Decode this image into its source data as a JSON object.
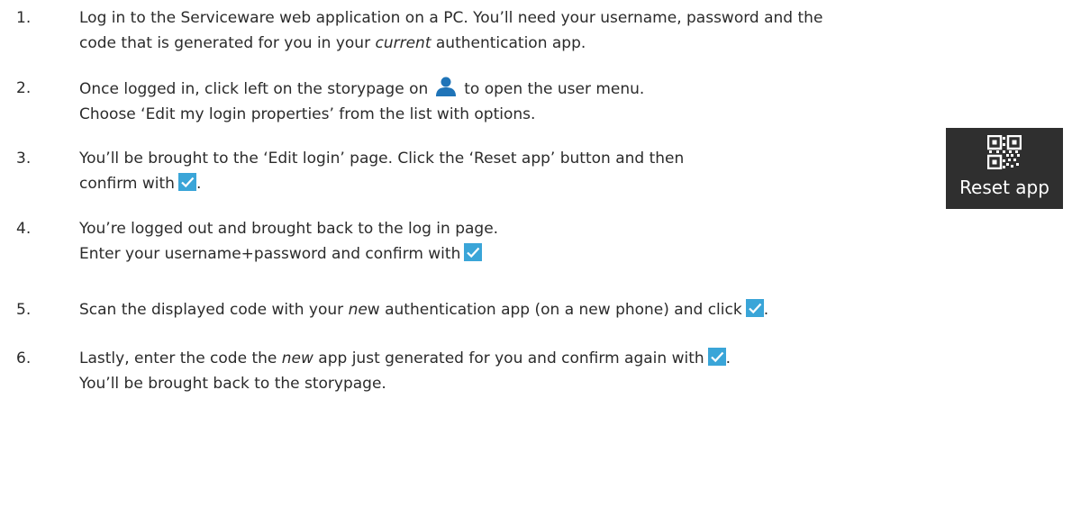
{
  "steps": [
    {
      "num": "1.",
      "line1": "Log in to the Serviceware web application on a PC. You’ll need your username, password and the",
      "line2_pre": "code that is generated for you in your ",
      "line2_em": "current",
      "line2_post": " authentication app."
    },
    {
      "num": "2.",
      "line1_pre": "Once logged in, click left on the storypage on",
      "line1_post": "to open the user menu.",
      "line2": "Choose ‘Edit my login properties’ from the list with options."
    },
    {
      "num": "3.",
      "line1": "You’ll be brought to the ‘Edit login’ page. Click the ‘Reset app’ button and then",
      "line2": "confirm with",
      "line2_end": "."
    },
    {
      "num": "4.",
      "line1": "You’re logged out and brought back to the log in page.",
      "line2": "Enter your username+password and confirm with"
    },
    {
      "num": "5.",
      "line1_pre": "Scan the displayed code with your ",
      "line1_em": "ne",
      "line1_post": "w authentication app (on a new phone) and click",
      "line1_end": "."
    },
    {
      "num": "6.",
      "line1_pre": "Lastly, enter the code the ",
      "line1_em": "new",
      "line1_post": " app just generated for you and confirm again with",
      "line1_end": ".",
      "line2": "You’ll be brought back to the storypage."
    }
  ],
  "reset_button": {
    "label": "Reset app"
  },
  "icons": {
    "user": "user-icon",
    "check": "checkmark-icon",
    "qr": "qr-code-icon"
  },
  "colors": {
    "check_bg": "#3aa5d8",
    "user_icon": "#1f74b8",
    "reset_bg": "#2f2f2f"
  }
}
